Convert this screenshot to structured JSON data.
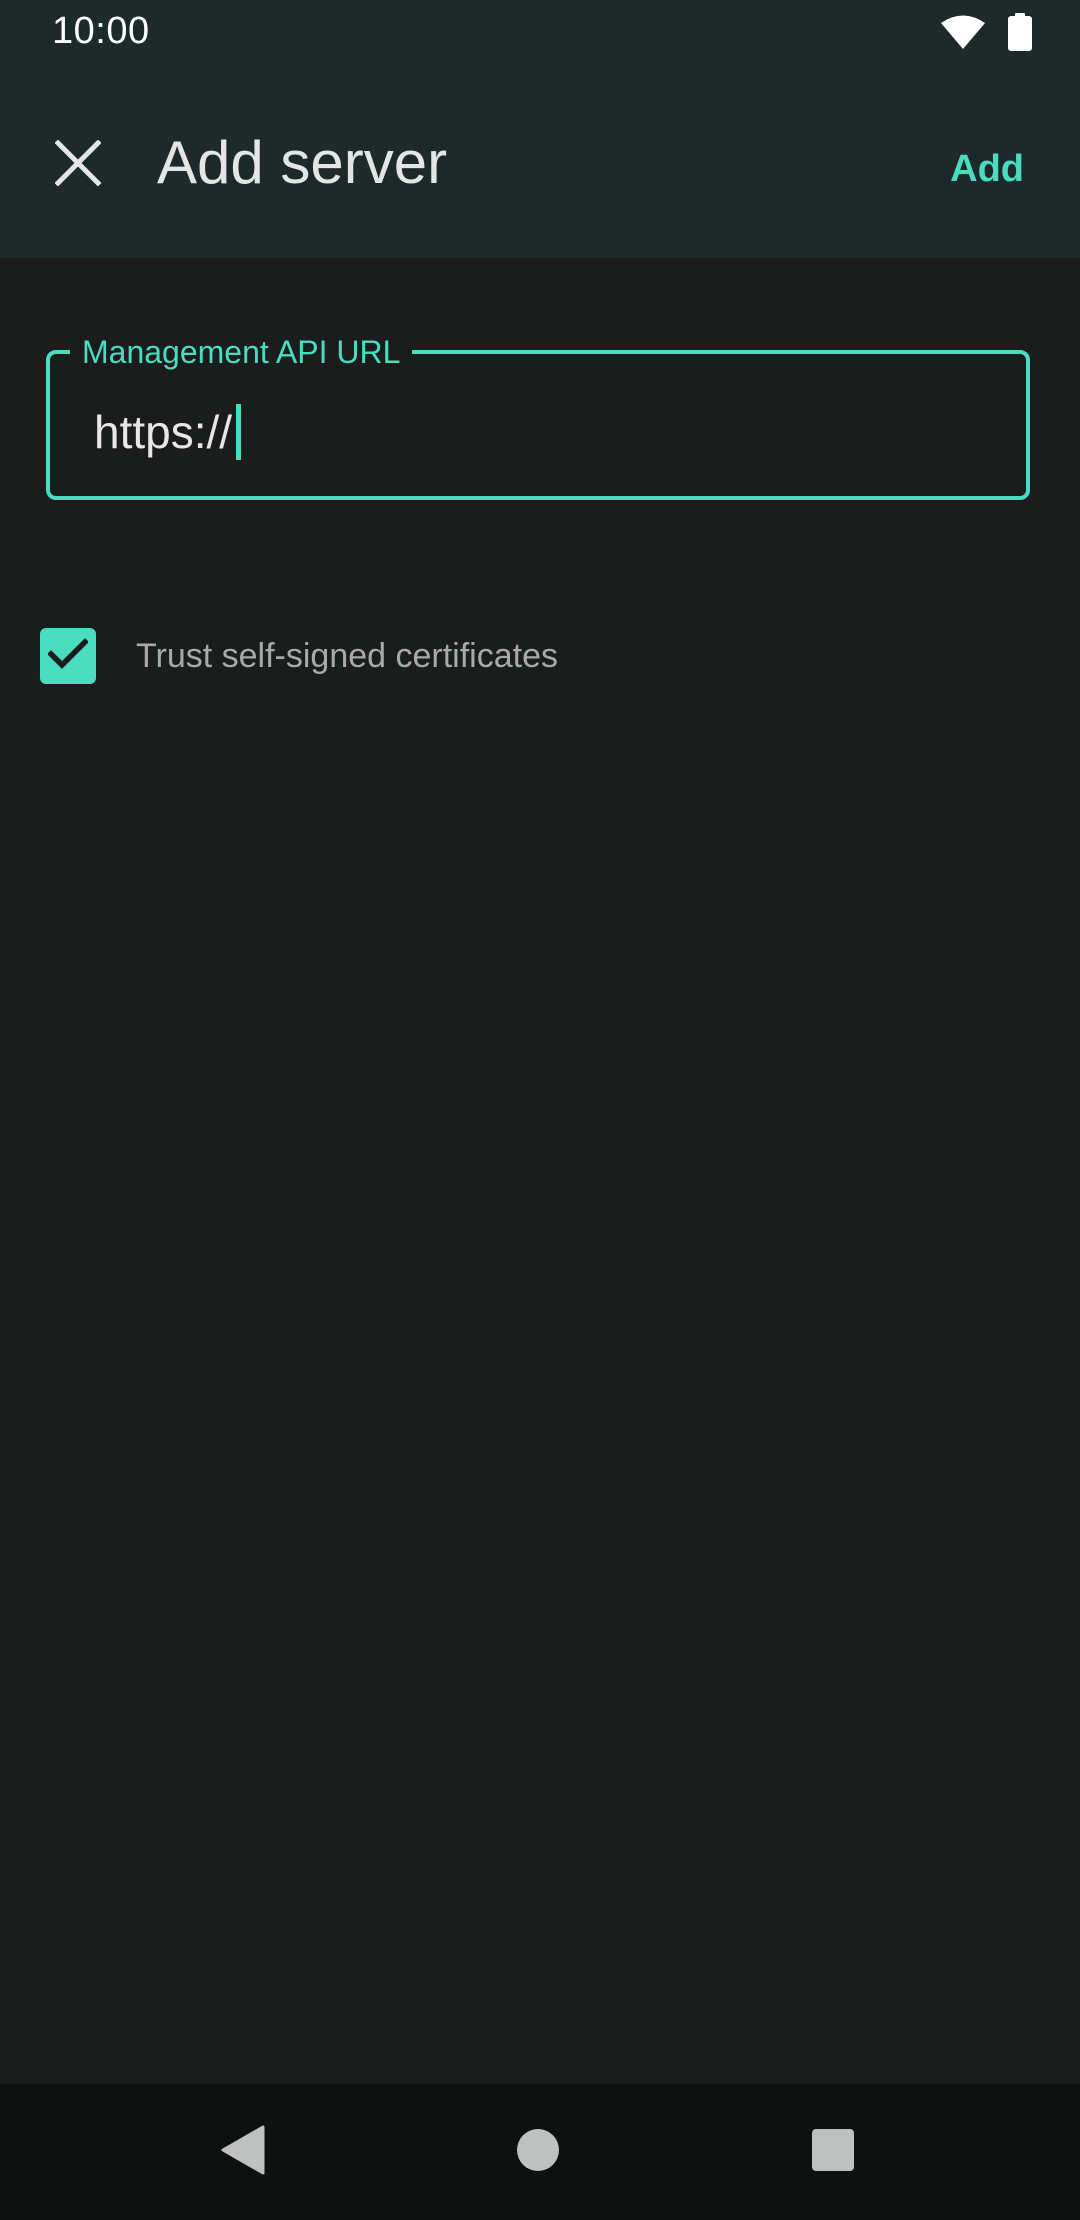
{
  "status_bar": {
    "time": "10:00",
    "icons": [
      "wifi-icon",
      "battery-icon"
    ]
  },
  "app_bar": {
    "close_icon": "close-icon",
    "title": "Add server",
    "action_label": "Add"
  },
  "form": {
    "url_field": {
      "label": "Management API URL",
      "value": "https://"
    },
    "trust_checkbox": {
      "label": "Trust self-signed certificates",
      "checked": true
    }
  },
  "nav_bar": {
    "icons": [
      "back-icon",
      "home-icon",
      "recents-icon"
    ]
  },
  "colors": {
    "accent": "#49dcbf",
    "app_bar_bg": "#1d2a29",
    "background": "#1b1c1c",
    "nav_bar_bg": "#0f1010"
  }
}
